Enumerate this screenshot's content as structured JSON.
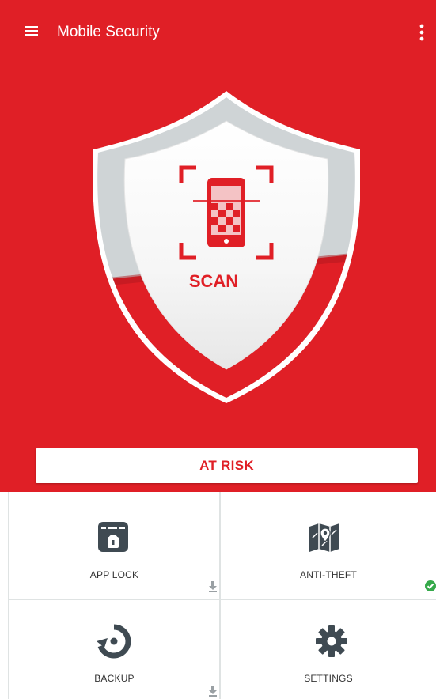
{
  "app_bar": {
    "title": "Mobile Security",
    "menu_icon": "hamburger-menu-icon",
    "overflow_icon": "more-vertical-icon"
  },
  "scan": {
    "label": "SCAN",
    "icon": "phone-scan-icon"
  },
  "status": {
    "label": "AT RISK"
  },
  "tiles": [
    {
      "label": "APP LOCK",
      "icon": "app-lock-icon",
      "badge": "download-icon"
    },
    {
      "label": "ANTI-THEFT",
      "icon": "map-pin-icon",
      "badge": "check-circle-icon"
    },
    {
      "label": "BACKUP",
      "icon": "backup-restore-icon",
      "badge": "download-icon"
    },
    {
      "label": "SETTINGS",
      "icon": "gear-icon"
    }
  ],
  "colors": {
    "accent": "#e01f26",
    "tile_icon": "#3f4a52",
    "ok_green": "#35a94a"
  }
}
